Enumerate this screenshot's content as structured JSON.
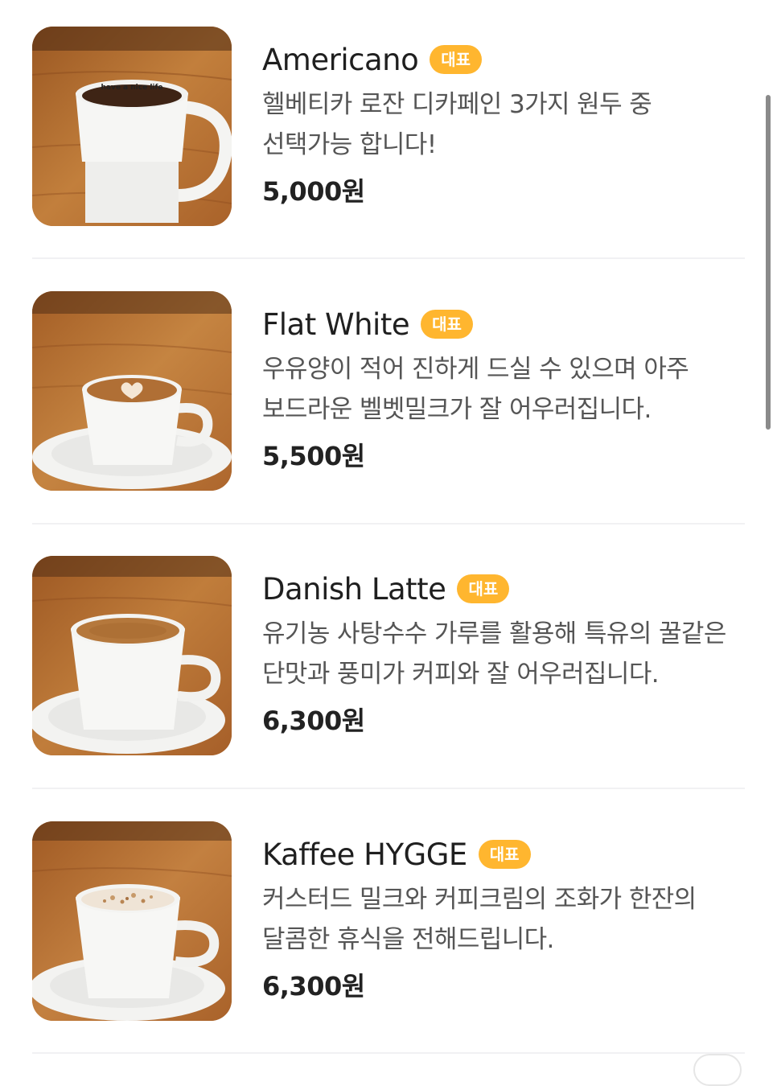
{
  "menu": {
    "items": [
      {
        "name": "Americano",
        "badge": "대표",
        "description": "헬베티카 로잔 디카페인 3가지 원두 중 선택가능 합니다!",
        "price": "5,000원",
        "image_icon": "americano-cup-image"
      },
      {
        "name": "Flat White",
        "badge": "대표",
        "description": "우유양이 적어 진하게 드실 수 있으며 아주 보드라운 벨벳밀크가 잘 어우러집니다.",
        "price": "5,500원",
        "image_icon": "flat-white-cup-image"
      },
      {
        "name": "Danish Latte",
        "badge": "대표",
        "description": "유기농 사탕수수 가루를 활용해 특유의 꿀같은 단맛과 풍미가 커피와 잘 어우러집니다.",
        "price": "6,300원",
        "image_icon": "danish-latte-cup-image"
      },
      {
        "name": "Kaffee HYGGE",
        "badge": "대표",
        "description": "커스터드 밀크와 커피크림의 조화가 한잔의 달콤한 휴식을 전해드립니다.",
        "price": "6,300원",
        "image_icon": "kaffee-hygge-cup-image"
      }
    ]
  },
  "colors": {
    "badge": "#ffb62f",
    "name_text": "#1f1f1f",
    "description_text": "#555555",
    "price_text": "#222222",
    "divider": "#f1f1f3",
    "wood_table": "#b26a2b"
  }
}
